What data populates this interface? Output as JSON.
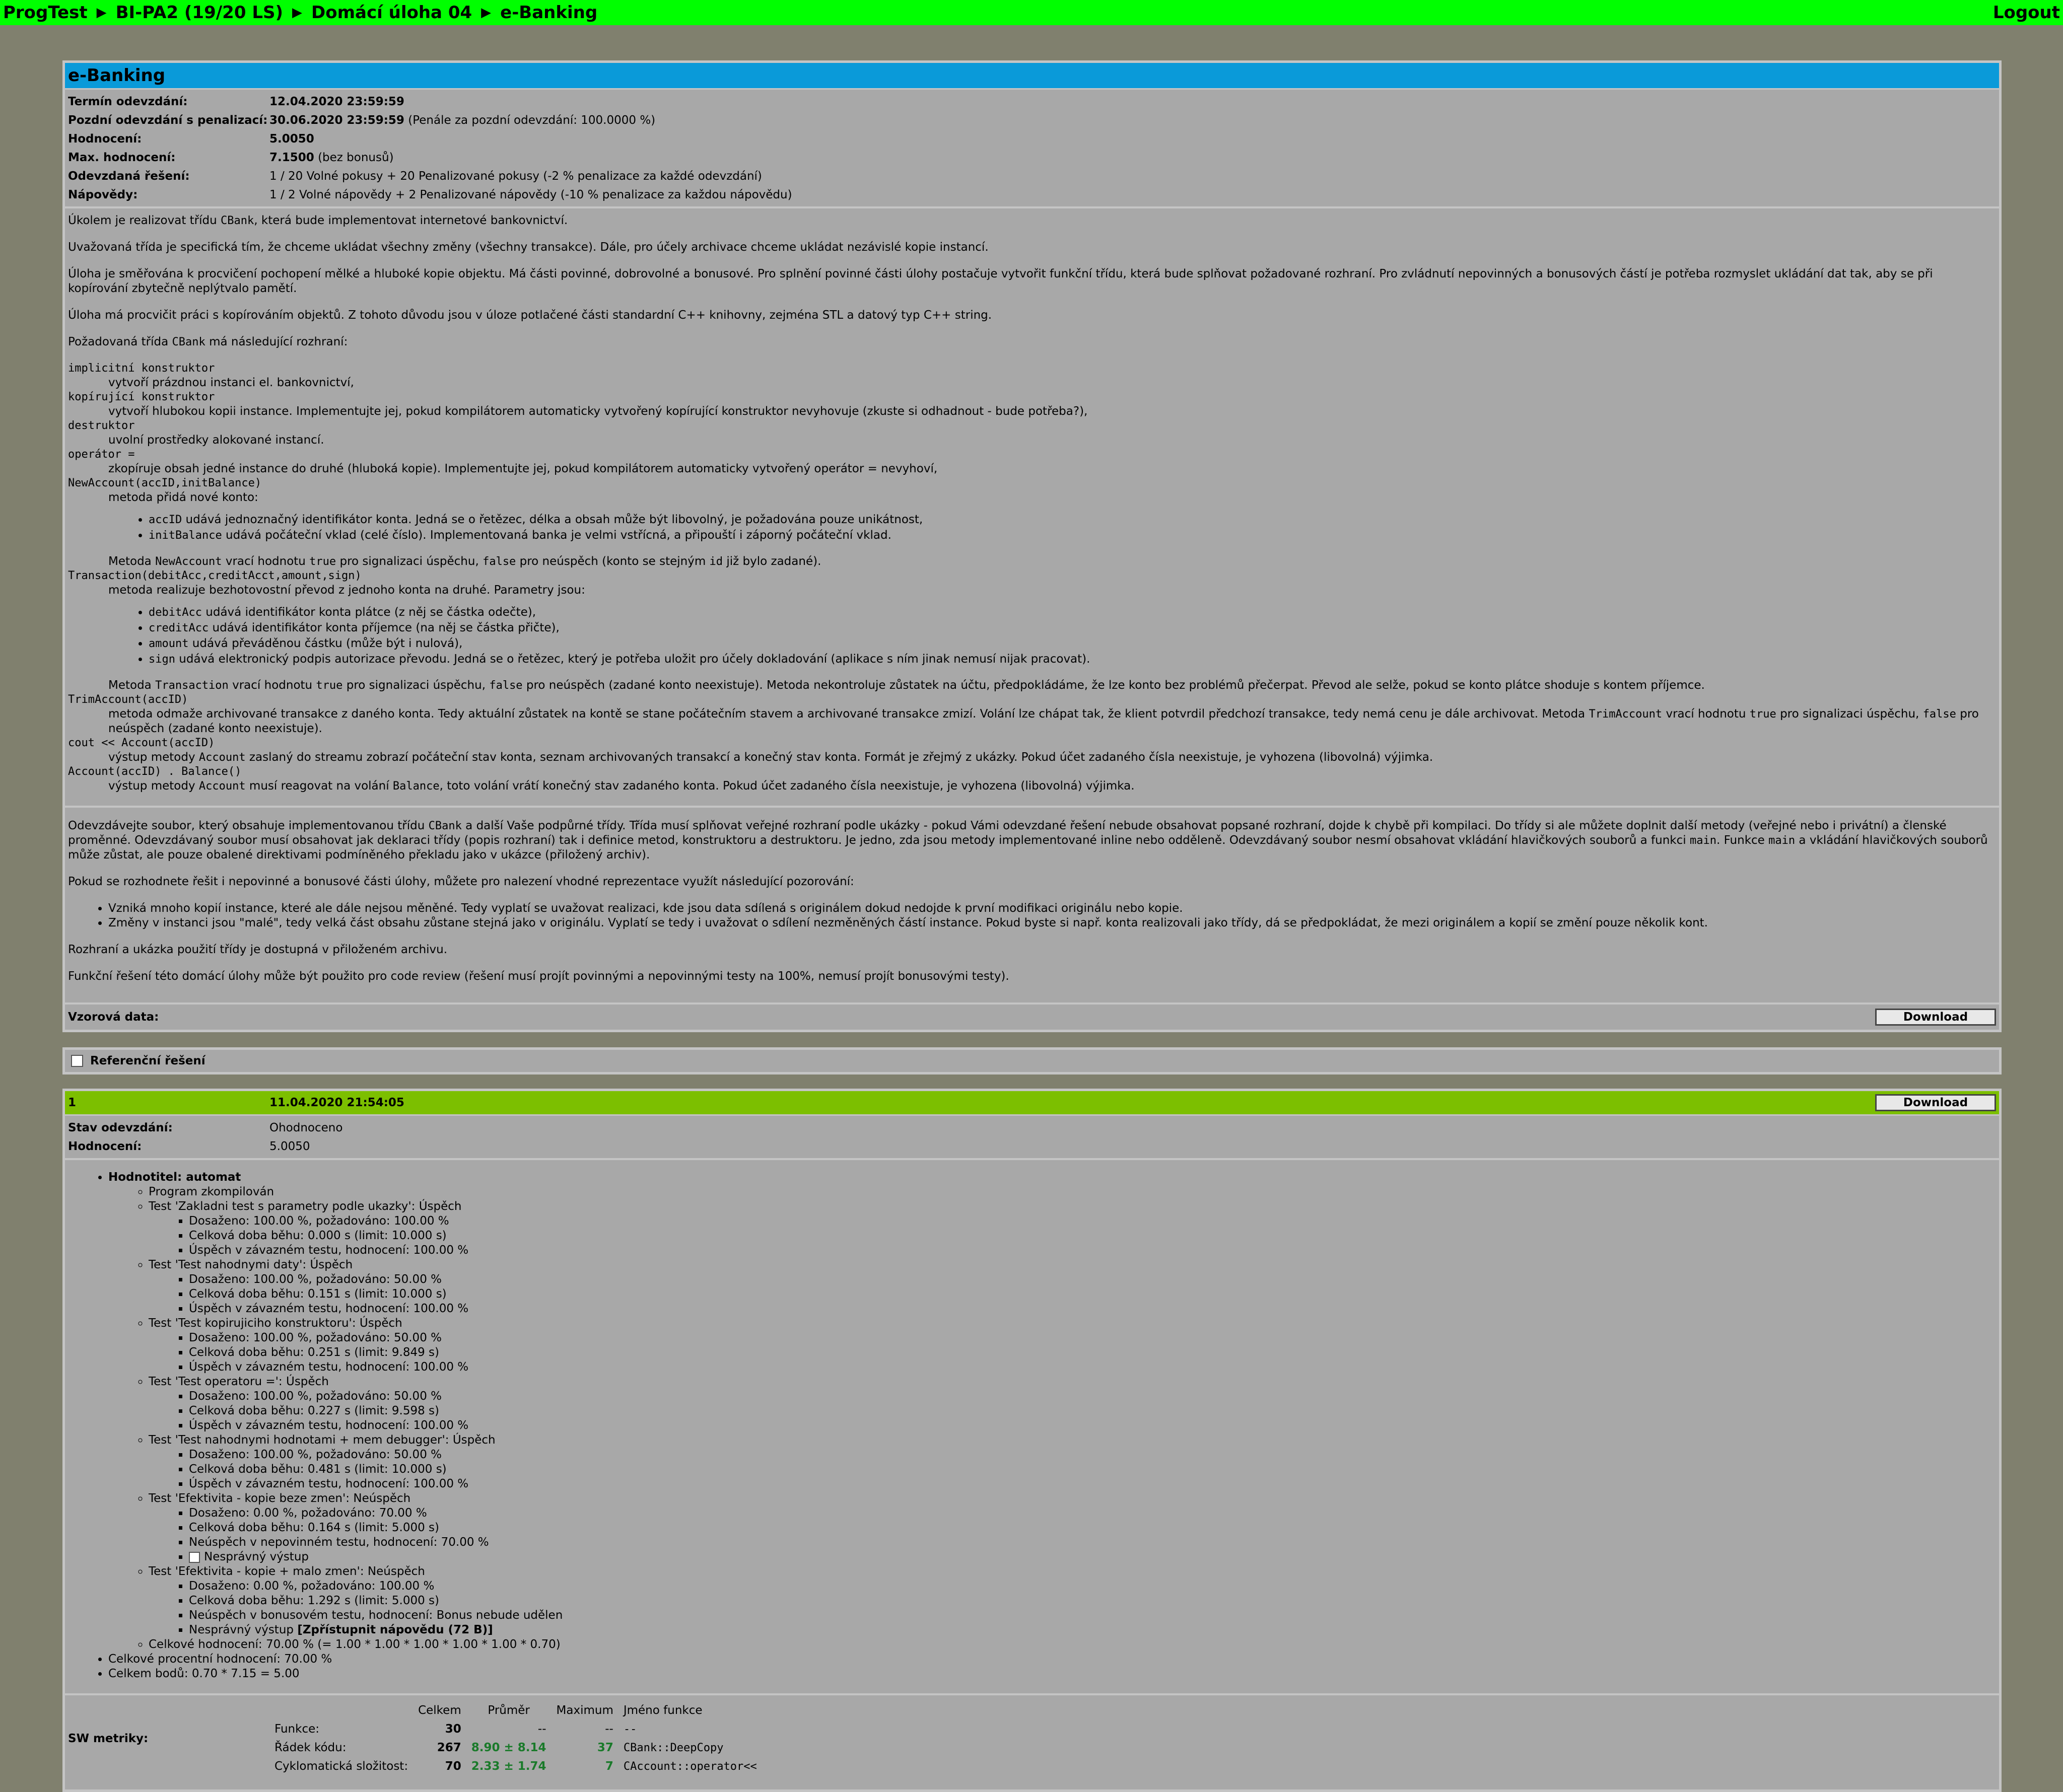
{
  "nav": {
    "crumbs": [
      "ProgTest",
      "BI-PA2 (19/20 LS)",
      "Domácí úloha 04",
      "e-Banking"
    ],
    "separator": "▶",
    "logout": "Logout"
  },
  "task": {
    "title": "e-Banking",
    "info": [
      {
        "label": "Termín odevzdání:",
        "value": "12.04.2020 23:59:59",
        "extra": ""
      },
      {
        "label": "Pozdní odevzdání s penalizací:",
        "value": "30.06.2020 23:59:59",
        "extra": " (Penále za pozdní odevzdání: 100.0000 %)"
      },
      {
        "label": "Hodnocení:",
        "value": "5.0050",
        "extra": ""
      },
      {
        "label": "Max. hodnocení:",
        "value": "7.1500",
        "extra": " (bez bonusů)"
      },
      {
        "label": "Odevzdaná řešení:",
        "value": "",
        "extra": "1 / 20 Volné pokusy + 20 Penalizované pokusy (-2 % penalizace za každé odevzdání)"
      },
      {
        "label": "Nápovědy:",
        "value": "",
        "extra": "1 / 2 Volné nápovědy + 2 Penalizované nápovědy (-10 % penalizace za každou nápovědu)"
      }
    ],
    "p1a": "Úkolem je realizovat třídu ",
    "cbank": "CBank",
    "p1b": ", která bude implementovat internetové bankovnictví.",
    "p2": "Uvažovaná třída je specifická tím, že chceme ukládat všechny změny (všechny transakce). Dále, pro účely archivace chceme ukládat nezávislé kopie instancí.",
    "p3": "Úloha je směřována k procvičení pochopení mělké a hluboké kopie objektu. Má části povinné, dobrovolné a bonusové. Pro splnění povinné části úlohy postačuje vytvořit funkční třídu, která bude splňovat požadované rozhraní. Pro zvládnutí nepovinných a bonusových částí je potřeba rozmyslet ukládání dat tak, aby se při kopírování zbytečně neplýtvalo pamětí.",
    "p4": "Úloha má procvičit práci s kopírováním objektů. Z tohoto důvodu jsou v úloze potlačené části standardní C++ knihovny, zejména STL a datový typ C++ string.",
    "p5a": "Požadovaná třída ",
    "p5b": " má následující rozhraní:",
    "d1t": "implicitní konstruktor",
    "d1d": "vytvoří prázdnou instanci el. bankovnictví,",
    "d2t": "kopírující konstruktor",
    "d2d": "vytvoří hlubokou kopii instance. Implementujte jej, pokud kompilátorem automaticky vytvořený kopírující konstruktor nevyhovuje (zkuste si odhadnout - bude potřeba?),",
    "d3t": "destruktor",
    "d3d": "uvolní prostředky alokované instancí.",
    "d4t": "operátor =",
    "d4d": "zkopíruje obsah jedné instance do druhé (hluboká kopie). Implementujte jej, pokud kompilátorem automaticky vytvořený operátor = nevyhoví,",
    "d5t": "NewAccount(accID,initBalance)",
    "d5d": "metoda přidá nové konto:",
    "d5l1c": "accID",
    "d5l1": " udává jednoznačný identifikátor konta. Jedná se o řetězec, délka a obsah může být libovolný, je požadována pouze unikátnost,",
    "d5l2c": "initBalance",
    "d5l2": " udává počáteční vklad (celé číslo). Implementovaná banka je velmi vstřícná, a připouští i záporný počáteční vklad.",
    "d5r1": "Metoda ",
    "d5r2": "NewAccount",
    "d5r3": " vrací hodnotu ",
    "true": "true",
    "false": "false",
    "id": "id",
    "d5r4": " pro signalizaci úspěchu, ",
    "d5r5": " pro neúspěch (konto se stejným ",
    "d5r6": " již bylo zadané).",
    "d6t": "Transaction(debitAcc,creditAcct,amount,sign)",
    "d6d": "metoda realizuje bezhotovostní převod z jednoho konta na druhé. Parametry jsou:",
    "d6l1c": "debitAcc",
    "d6l1": " udává identifikátor konta plátce (z něj se částka odečte),",
    "d6l2c": "creditAcc",
    "d6l2": " udává identifikátor konta příjemce (na něj se částka přičte),",
    "d6l3c": "amount",
    "d6l3": " udává převáděnou částku (může být i nulová),",
    "d6l4c": "sign",
    "d6l4": " udává elektronický podpis autorizace převodu. Jedná se o řetězec, který je potřeba uložit pro účely dokladování (aplikace s ním jinak nemusí nijak pracovat).",
    "d6r2": "Transaction",
    "d6r5": " pro neúspěch (zadané konto neexistuje). Metoda nekontroluje zůstatek na účtu, předpokládáme, že lze konto bez problémů přečerpat. Převod ale selže, pokud se konto plátce shoduje s kontem příjemce.",
    "d7t": "TrimAccount(accID)",
    "d7a": "metoda odmaže archivované transakce z daného konta. Tedy aktuální zůstatek na kontě se stane počátečním stavem a archivované transakce zmizí. Volání lze chápat tak, že klient potvrdil předchozí transakce, tedy nemá cenu je dále archivovat. Metoda ",
    "d7c": "TrimAccount",
    "d7b": " pro neúspěch (zadané konto neexistuje).",
    "d8t": "cout << Account(accID)",
    "d8a": "výstup metody ",
    "d8c": "Account",
    "d8b": " zaslaný do streamu zobrazí počáteční stav konta, seznam archivovaných transakcí a konečný stav konta. Formát je zřejmý z ukázky. Pokud účet zadaného čísla neexistuje, je vyhozena (libovolná) výjimka.",
    "d9t": "Account(accID) . Balance()",
    "d9b": " musí reagovat na volání ",
    "d9c": "Balance",
    "d9e": ", toto volání vrátí konečný stav zadaného konta. Pokud účet zadaného čísla neexistuje, je vyhozena (libovolná) výjimka.",
    "q1a": "Odevzdávejte soubor, který obsahuje implementovanou třídu ",
    "q1b": " a další Vaše podpůrné třídy. Třída musí splňovat veřejné rozhraní podle ukázky - pokud Vámi odevzdané řešení nebude obsahovat popsané rozhraní, dojde k chybě při kompilaci. Do třídy si ale můžete doplnit další metody (veřejné nebo i privátní) a členské proměnné. Odevzdávaný soubor musí obsahovat jak deklaraci třídy (popis rozhraní) tak i definice metod, konstruktoru a destruktoru. Je jedno, zda jsou metody implementované inline nebo odděleně. Odevzdávaný soubor nesmí obsahovat vkládání hlavičkových souborů a funkci ",
    "main": "main",
    "q1c": ". Funkce ",
    "q1d": " a vkládání hlavičkových souborů může zůstat, ale pouze obalené direktivami podmíněného překladu jako v ukázce (přiložený archiv).",
    "q2": "Pokud se rozhodnete řešit i nepovinné a bonusové části úlohy, můžete pro nalezení vhodné reprezentace využít následující pozorování:",
    "q2l1": "Vzniká mnoho kopií instance, které ale dále nejsou měněné. Tedy vyplatí se uvažovat realizaci, kde jsou data sdílená s originálem dokud nedojde k první modifikaci originálu nebo kopie.",
    "q2l2": "Změny v instanci jsou \"malé\", tedy velká část obsahu zůstane stejná jako v originálu. Vyplatí se tedy i uvažovat o sdílení nezměněných částí instance. Pokud byste si např. konta realizovali jako třídy, dá se předpokládat, že mezi originálem a kopií se změní pouze několik kont.",
    "q3": "Rozhraní a ukázka použití třídy je dostupná v přiloženém archivu.",
    "q4": "Funkční řešení této domácí úlohy může být použito pro code review (řešení musí projít povinnými a nepovinnými testy na 100%, nemusí projít bonusovými testy).",
    "sample_label": "Vzorová data:",
    "download": "Download"
  },
  "reference": {
    "label": "Referenční řešení"
  },
  "submission": {
    "number": "1",
    "date": "11.04.2020 21:54:05",
    "download": "Download",
    "status_label": "Stav odevzdání:",
    "status": "Ohodnoceno",
    "score_label": "Hodnocení:",
    "score": "5.0050",
    "grader": "Hodnotitel: automat",
    "compiled": "Program zkompilován",
    "tests": [
      {
        "name": "Test 'Zakladni test s parametry podle ukazky': Úspěch",
        "lines": [
          "Dosaženo: 100.00 %, požadováno: 100.00 %",
          "Celková doba běhu: 0.000 s (limit: 10.000 s)",
          "Úspěch v závazném testu, hodnocení: 100.00 %"
        ]
      },
      {
        "name": "Test 'Test nahodnymi daty': Úspěch",
        "lines": [
          "Dosaženo: 100.00 %, požadováno: 50.00 %",
          "Celková doba běhu: 0.151 s (limit: 10.000 s)",
          "Úspěch v závazném testu, hodnocení: 100.00 %"
        ]
      },
      {
        "name": "Test 'Test kopirujiciho konstruktoru': Úspěch",
        "lines": [
          "Dosaženo: 100.00 %, požadováno: 50.00 %",
          "Celková doba běhu: 0.251 s (limit: 9.849 s)",
          "Úspěch v závazném testu, hodnocení: 100.00 %"
        ]
      },
      {
        "name": "Test 'Test operatoru =': Úspěch",
        "lines": [
          "Dosaženo: 100.00 %, požadováno: 50.00 %",
          "Celková doba běhu: 0.227 s (limit: 9.598 s)",
          "Úspěch v závazném testu, hodnocení: 100.00 %"
        ]
      },
      {
        "name": "Test 'Test nahodnymi hodnotami + mem debugger': Úspěch",
        "lines": [
          "Dosaženo: 100.00 %, požadováno: 50.00 %",
          "Celková doba běhu: 0.481 s (limit: 10.000 s)",
          "Úspěch v závazném testu, hodnocení: 100.00 %"
        ]
      },
      {
        "name": "Test 'Efektivita - kopie beze zmen': Neúspěch",
        "lines": [
          "Dosaženo: 0.00 %, požadováno: 70.00 %",
          "Celková doba běhu: 0.164 s (limit: 5.000 s)",
          "Neúspěch v nepovinném testu, hodnocení: 70.00 %"
        ],
        "extra_checkbox": "Nesprávný výstup"
      },
      {
        "name": "Test 'Efektivita - kopie + malo zmen': Neúspěch",
        "lines": [
          "Dosaženo: 0.00 %, požadováno: 100.00 %",
          "Celková doba běhu: 1.292 s (limit: 5.000 s)",
          "Neúspěch v bonusovém testu, hodnocení: Bonus nebude udělen"
        ],
        "extra_hint": "Nesprávný výstup",
        "hint": "[Zpřístupnit nápovědu (72 B)]"
      }
    ],
    "overall_inner": "Celkové hodnocení: 70.00 % (= 1.00 * 1.00 * 1.00 * 1.00 * 1.00 * 0.70)",
    "overall_percent": "Celkové procentní hodnocení: 70.00 %",
    "overall_points": "Celkem bodů: 0.70 * 7.15 = 5.00",
    "metrics": {
      "label": "SW metriky:",
      "headers": [
        "Celkem",
        "Průměr",
        "Maximum",
        "Jméno funkce"
      ],
      "rows": [
        {
          "name": "Funkce:",
          "total": "30",
          "avg": "--",
          "max": "--",
          "fn": "--"
        },
        {
          "name": "Řádek kódu:",
          "total": "267",
          "avg": "8.90 ± 8.14",
          "max": "37",
          "fn": "CBank::DeepCopy"
        },
        {
          "name": "Cyklomatická složitost:",
          "total": "70",
          "avg": "2.33 ± 1.74",
          "max": "7",
          "fn": "CAccount::operator<<"
        }
      ]
    }
  }
}
